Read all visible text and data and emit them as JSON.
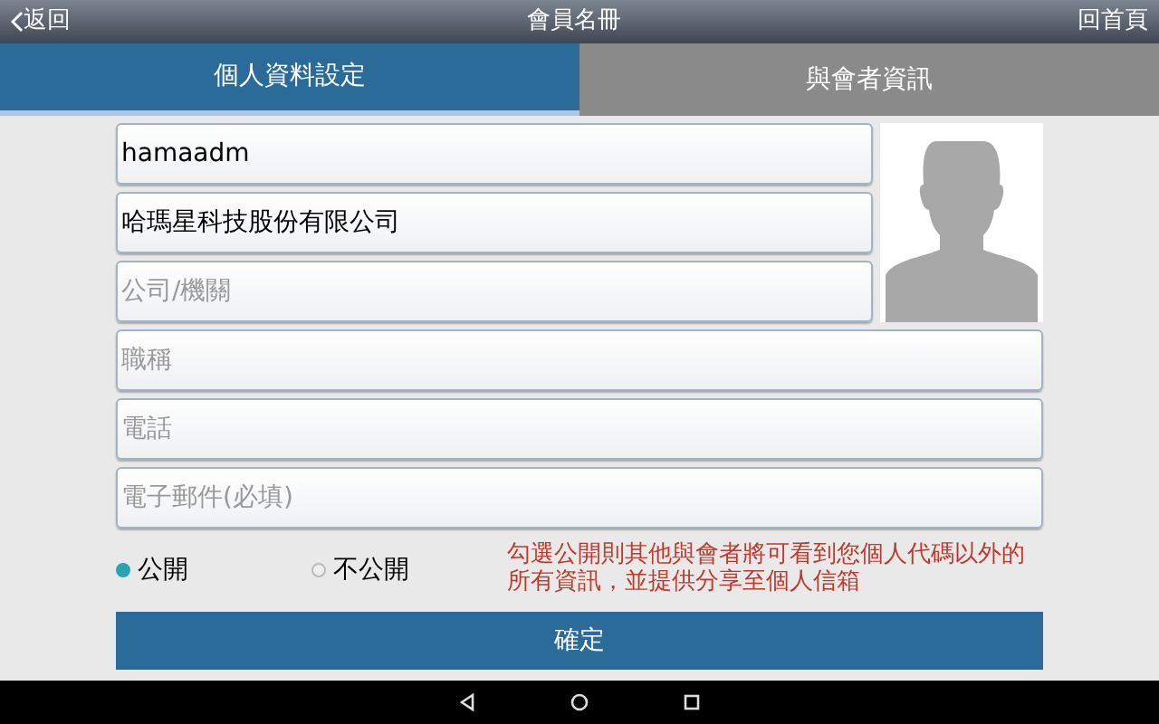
{
  "top_bar": {
    "back": "返回",
    "title": "會員名冊",
    "home": "回首頁"
  },
  "tabs": [
    {
      "label": "個人資料設定",
      "selected": true
    },
    {
      "label": "與會者資訊",
      "selected": false
    }
  ],
  "fields_beside_photo": [
    {
      "value": "hamaadm"
    },
    {
      "value": "哈瑪星科技股份有限公司"
    },
    {
      "placeholder": "公司/機關"
    }
  ],
  "fields": [
    {
      "placeholder": "職稱"
    },
    {
      "placeholder": "電話"
    },
    {
      "placeholder": "電子郵件(必填)"
    }
  ],
  "visibility": {
    "options": [
      {
        "label": "公開",
        "selected": true
      },
      {
        "label": "不公開",
        "selected": false
      }
    ],
    "note": "勾選公開則其他與會者將可看到您個人代碼以外的所有資訊，並提供分享至個人信箱"
  },
  "submit": "確定"
}
